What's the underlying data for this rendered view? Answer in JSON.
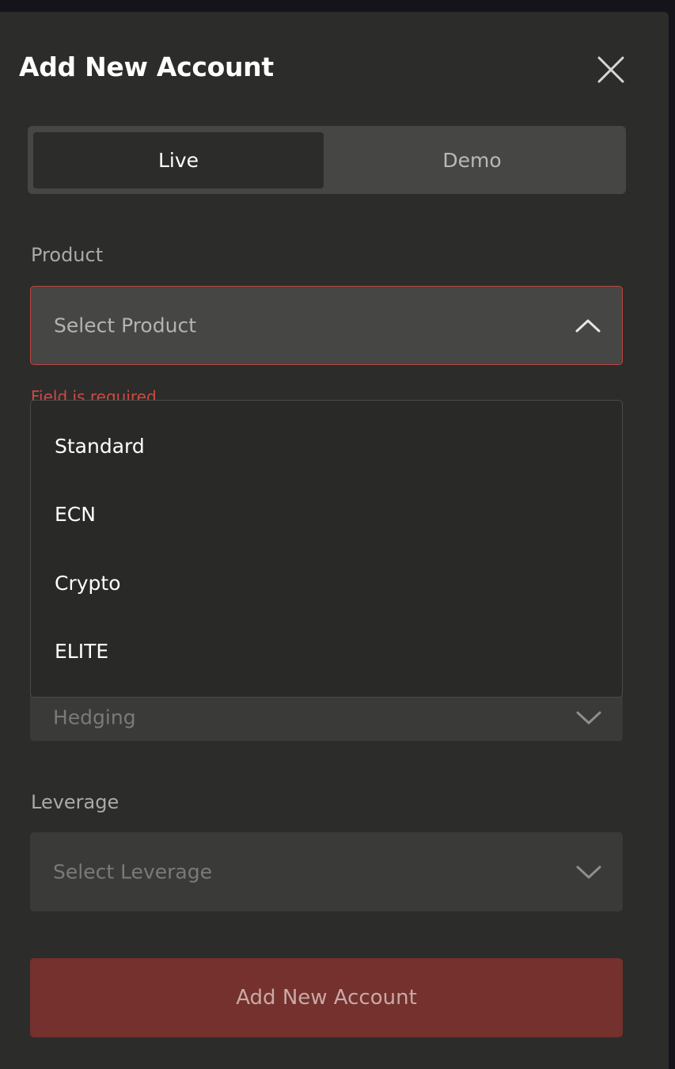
{
  "modal": {
    "title": "Add New Account",
    "close_icon": "close-icon"
  },
  "tabs": [
    {
      "label": "Live",
      "active": true
    },
    {
      "label": "Demo",
      "active": false
    }
  ],
  "product": {
    "label": "Product",
    "placeholder": "Select Product",
    "error": "Field is required",
    "expanded": true,
    "options": [
      "Standard",
      "ECN",
      "Crypto",
      "ELITE"
    ]
  },
  "account_type": {
    "value": "Hedging"
  },
  "leverage": {
    "label": "Leverage",
    "placeholder": "Select Leverage"
  },
  "submit": {
    "label": "Add New Account"
  },
  "colors": {
    "modal_bg": "#2c2c2a",
    "error": "#c0433f",
    "button": "#74312d"
  }
}
